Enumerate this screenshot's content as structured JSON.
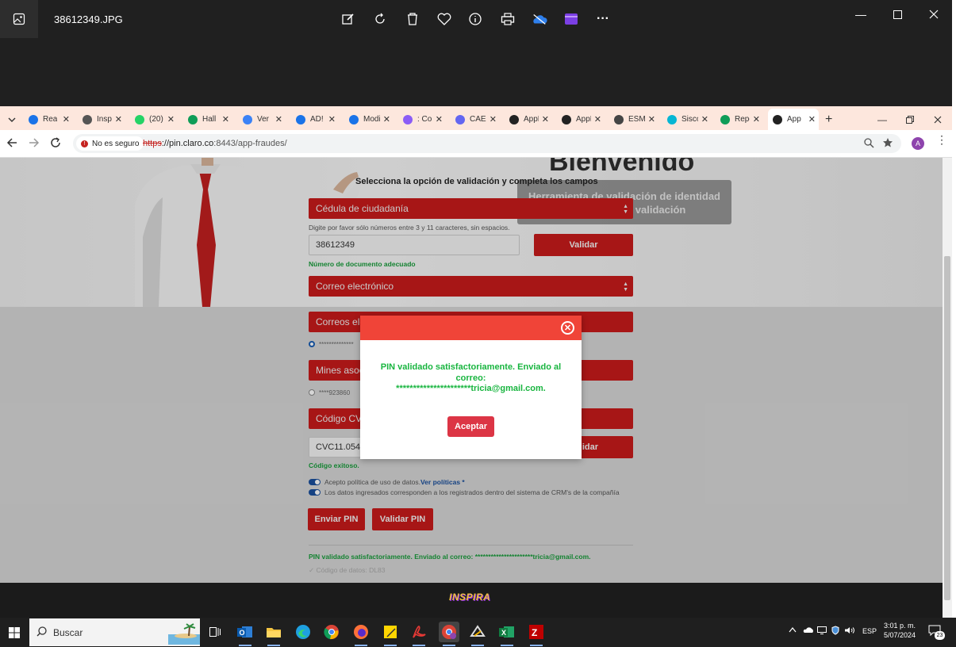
{
  "viewer": {
    "file_name": "38612349.JPG",
    "toolbar_icons": [
      "edit-icon",
      "rotate-icon",
      "delete-icon",
      "favorite-icon",
      "info-icon",
      "print-icon",
      "onedrive-icon",
      "clipchamp-icon",
      "more-icon"
    ],
    "more": "···"
  },
  "browser": {
    "tabs": [
      {
        "label": "Rea",
        "icon": "globe-blue-icon",
        "color": "#1a73e8"
      },
      {
        "label": "Insp",
        "icon": "globe-icon",
        "color": "#555"
      },
      {
        "label": "(20)",
        "icon": "whatsapp-icon",
        "color": "#25d366"
      },
      {
        "label": "Hall",
        "icon": "sheets-icon",
        "color": "#0f9d58"
      },
      {
        "label": "Ver",
        "icon": "pen-icon",
        "color": "#3b82f6"
      },
      {
        "label": "AD!",
        "icon": "globe-blue-icon",
        "color": "#1a73e8"
      },
      {
        "label": "Modify",
        "icon": "globe-blue-icon",
        "color": "#1a73e8"
      },
      {
        "label": ": Conso",
        "icon": "id-icon",
        "color": "#8b5cf6"
      },
      {
        "label": "CAEX [P",
        "icon": "x-icon",
        "color": "#6366f1"
      },
      {
        "label": "AppFrau",
        "icon": "angular-icon",
        "color": "#222"
      },
      {
        "label": "AppFrau",
        "icon": "angular-icon",
        "color": "#222"
      },
      {
        "label": "ESM LO",
        "icon": "gear-icon",
        "color": "#444"
      },
      {
        "label": "Siscore",
        "icon": "globe-icon",
        "color": "#06b6d4"
      },
      {
        "label": "Reporte",
        "icon": "sheets-icon",
        "color": "#0f9d58"
      },
      {
        "label": "App",
        "icon": "angular-icon",
        "color": "#222"
      }
    ],
    "new_tab": "+",
    "security_label": "No es seguro",
    "url_scheme": "https",
    "url_rest": "://pin.claro.co",
    "url_port_path": ":8443/app-fraudes/",
    "profile_initial": "A"
  },
  "page": {
    "welcome": "Bienvenido",
    "tool_title_line1": "Herramienta de validación de identidad",
    "tool_title_line2": "de validación",
    "select_label": "Selecciona la opción de validación y completa los campos",
    "doc_type": "Cédula de ciudadanía",
    "doc_hint": "Digite por favor sólo números entre 3 y 11 caracteres, sin espacios.",
    "doc_value": "38612349",
    "validate_button": "Validar",
    "doc_ok": "Número de documento adecuado",
    "email_option": "Correo electrónico",
    "emails_header": "Correos ele",
    "email_masked": "**************",
    "mines_header": "Mines asoc",
    "mines_masked": "****923860",
    "cvc_header": "Código CVC",
    "cvc_value": "CVC11.054",
    "cvc_validate": "lidar",
    "cvc_ok": "Código exitoso.",
    "policy_text": "Acepto política de uso de datos.",
    "policy_link": "Ver políticas *",
    "data_text": "Los datos ingresados corresponden a los registrados dentro del sistema de CRM's de la compañía",
    "send_pin": "Enviar PIN",
    "validate_pin": "Validar PIN",
    "pin_status": "PIN validado satisfactoriamente. Enviado al correo: **********************tricia@gmail.com.",
    "data_code": "✓ Código de datos: DL83",
    "footer_logo": "INSPIRA"
  },
  "modal": {
    "message_line1": "PIN validado satisfactoriamente. Enviado al",
    "message_line2": "correo:",
    "message_line3": "**********************tricia@gmail.com.",
    "accept": "Aceptar"
  },
  "taskbar": {
    "search_placeholder": "Buscar",
    "apps": [
      "outlook-icon",
      "task-view-icon",
      "file-explorer-icon",
      "edge-icon",
      "chrome-icon",
      "firefox-icon",
      "sticky-notes-icon",
      "acrobat-icon",
      "chrome-profile-icon",
      "app-icon",
      "excel-icon",
      "filezilla-icon"
    ],
    "lang": "ESP",
    "time": "3:01 p. m.",
    "date": "5/07/2024",
    "notif_count": "23"
  },
  "colors": {
    "claro_red": "#c81b1b",
    "modal_header": "#f04438",
    "success_green": "#18b53f",
    "accept_button": "#dc3545"
  }
}
